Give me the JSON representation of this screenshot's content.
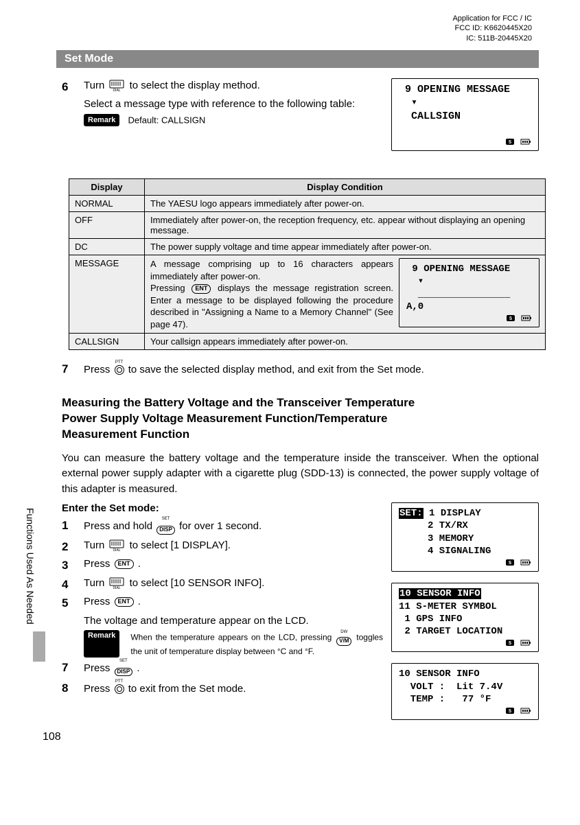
{
  "header": {
    "line1": "Application for FCC / IC",
    "line2": "FCC ID: K6620445X20",
    "line3": "IC: 511B-20445X20"
  },
  "section_bar": "Set Mode",
  "step6": {
    "num": "6",
    "line1_a": "Turn ",
    "line1_b": " to select the display method.",
    "line2": "Select a message type with reference to the following table:",
    "remark": "Default: CALLSIGN"
  },
  "lcd1": {
    "l1": " 9 OPENING MESSAGE",
    "l2": "  ▾",
    "l3": "  CALLSIGN"
  },
  "table": {
    "h1": "Display",
    "h2": "Display Condition",
    "rows": [
      {
        "d": "NORMAL",
        "c": "The YAESU logo appears immediately after power-on."
      },
      {
        "d": "OFF",
        "c": "Immediately after power-on, the reception frequency, etc. appear without displaying an opening message."
      },
      {
        "d": "DC",
        "c": "The power supply voltage and time appear immediately after power-on."
      }
    ],
    "message_row": {
      "d": "MESSAGE",
      "text_a": "A message comprising up to 16 characters appears immediately after power-on.",
      "text_b_pre": "Pressing ",
      "text_b_post": " displays the message registration screen. Enter a message to be displayed following the procedure described in \"Assigning a Name to a Memory Channel\" (See page 47)."
    },
    "callsign_row": {
      "d": "CALLSIGN",
      "c": "Your callsign appears immediately after power-on."
    }
  },
  "lcd_msg": {
    "l1": " 9 OPENING MESSAGE",
    "l2": "  ▾",
    "l3": "  ________________",
    "l4": "A,0"
  },
  "step7": {
    "num": "7",
    "text_a": "Press ",
    "text_b": " to save the selected display method, and exit from the Set mode."
  },
  "heading2": "Measuring the Battery Voltage and the Transceiver Temperature\nPower Supply Voltage Measurement Function/Temperature Measurement Function",
  "para1": "You can measure the battery voltage and the temperature inside the transceiver. When the optional external power supply adapter with a cigarette plug (SDD-13) is connected, the power supply voltage of this adapter is measured.",
  "enter_set": "Enter the Set mode:",
  "steps2": {
    "s1_num": "1",
    "s1_a": "Press and hold ",
    "s1_b": " for over 1 second.",
    "s2_num": "2",
    "s2_a": "Turn ",
    "s2_b": " to select [1 DISPLAY].",
    "s3_num": "3",
    "s3_a": "Press ",
    "s3_b": ".",
    "s4_num": "4",
    "s4_a": "Turn ",
    "s4_b": " to select [10 SENSOR INFO].",
    "s5_num": "5",
    "s5_a": "Press ",
    "s5_b": ".",
    "s5_line2": "The voltage and temperature appear on the LCD.",
    "s5_remark_a": "When the temperature appears on the LCD, pressing ",
    "s5_remark_b": " toggles the unit of temperature display between °C and °F.",
    "s7_num": "7",
    "s7_a": "Press ",
    "s7_b": ".",
    "s8_num": "8",
    "s8_a": "Press ",
    "s8_b": " to exit from the Set mode."
  },
  "lcd2": {
    "l1_pre": "SET:",
    "l1_post": " 1 DISPLAY",
    "l2": "     2 TX/RX",
    "l3": "     3 MEMORY",
    "l4": "     4 SIGNALING"
  },
  "lcd3": {
    "l1": "10 SENSOR INFO",
    "l2": "11 S-METER SYMBOL",
    "l3": " 1 GPS INFO",
    "l4": " 2 TARGET LOCATION"
  },
  "lcd4": {
    "l1": "10 SENSOR INFO",
    "l2": "",
    "l3": "  VOLT :  Lit 7.4V",
    "l4": "  TEMP :   77 °F"
  },
  "icons": {
    "ent": "ENT",
    "disp": "DISP",
    "set": "SET",
    "ptt": "PTT",
    "vm": "V/M",
    "dw": "DW",
    "remark": "Remark"
  },
  "side_tab": "Functions Used As Needed",
  "page_num": "108"
}
